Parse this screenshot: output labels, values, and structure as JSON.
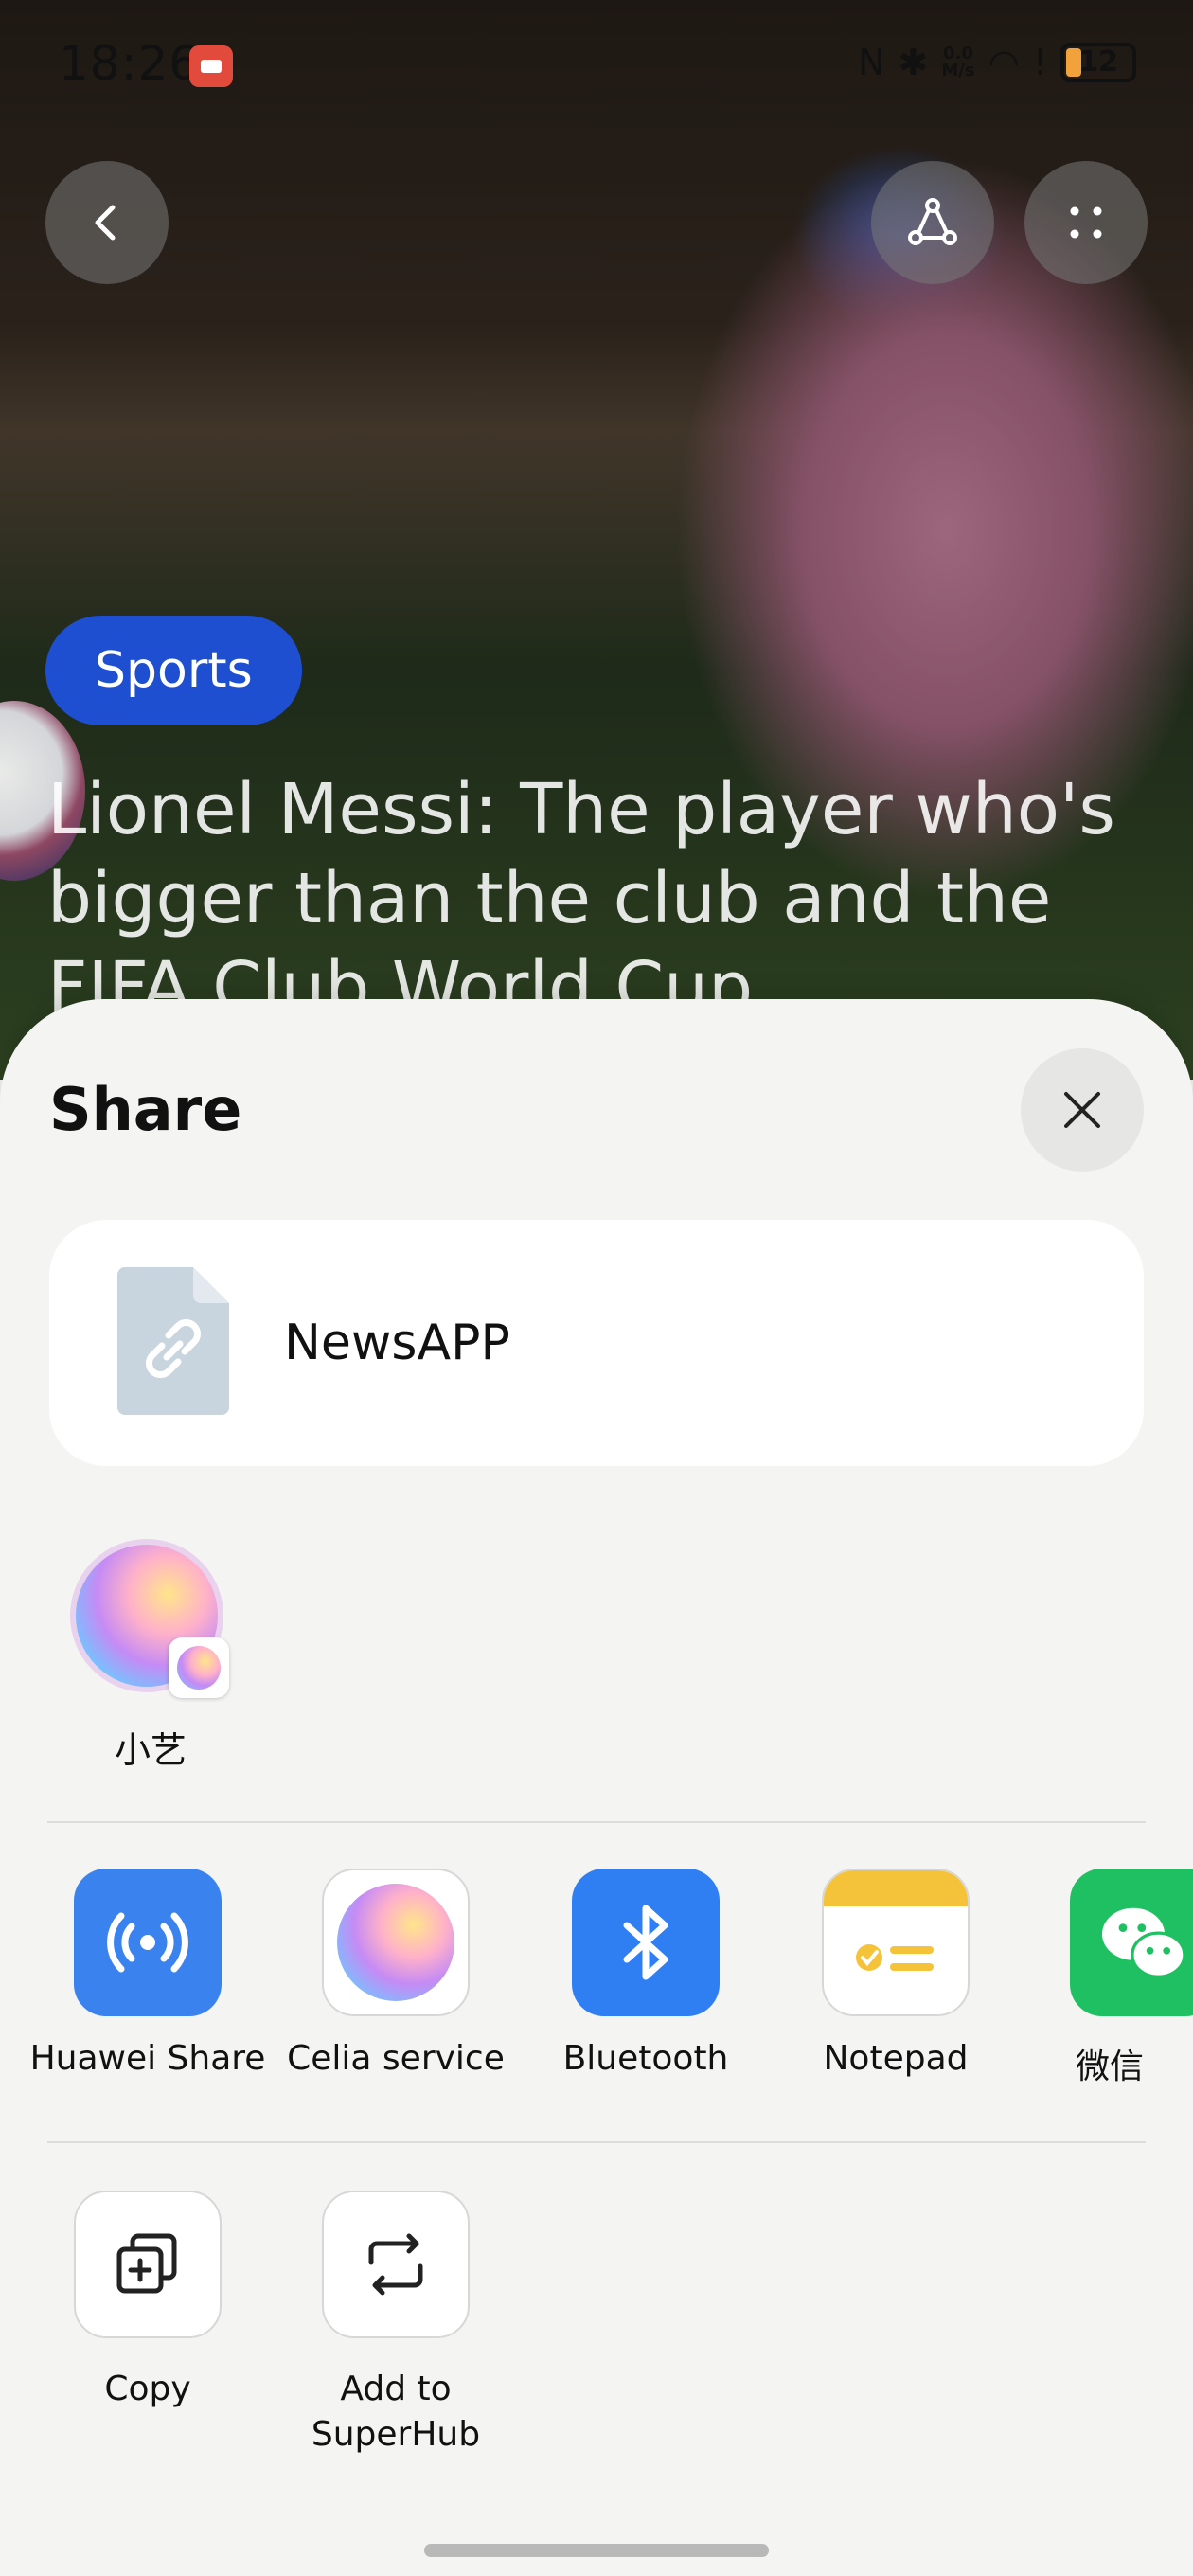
{
  "status_bar": {
    "time": "18:26",
    "network_speed_value": "0.0",
    "network_speed_unit": "M/s",
    "battery_level": "12",
    "battery_color": "#f2a23a"
  },
  "article": {
    "category": "Sports",
    "title": "Lionel Messi: The player who's bigger than the club and the FIFA Club World Cup"
  },
  "share_sheet": {
    "title": "Share",
    "file": {
      "name": "NewsAPP",
      "icon": "link-file-icon"
    },
    "contacts": [
      {
        "label": "小艺",
        "icon": "celia-avatar-icon"
      }
    ],
    "apps": [
      {
        "label": "Huawei Share",
        "icon": "huawei-share-icon",
        "color": "#3a82ee"
      },
      {
        "label": "Celia service",
        "icon": "celia-icon"
      },
      {
        "label": "Bluetooth",
        "icon": "bluetooth-icon",
        "color": "#2f7ff2"
      },
      {
        "label": "Notepad",
        "icon": "notepad-icon",
        "color": "#f5c33a"
      },
      {
        "label": "微信",
        "icon": "wechat-icon",
        "color": "#1fc062"
      }
    ],
    "actions": [
      {
        "label": "Copy",
        "icon": "copy-icon"
      },
      {
        "label": "Add to\nSuperHub",
        "icon": "superhub-icon"
      }
    ]
  }
}
